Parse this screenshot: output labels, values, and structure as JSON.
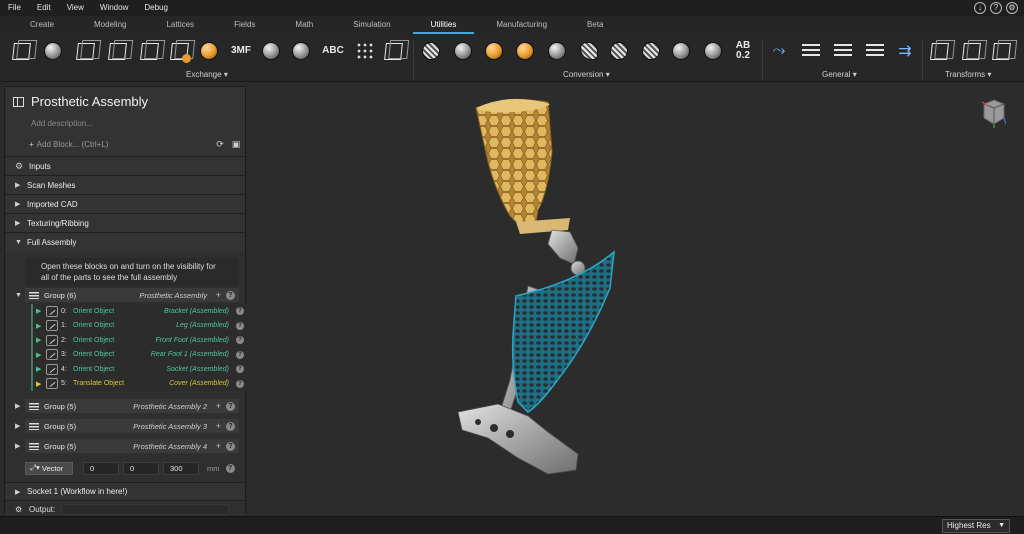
{
  "menu": [
    "File",
    "Edit",
    "View",
    "Window",
    "Debug"
  ],
  "window_icons": [
    "download-icon",
    "help-icon",
    "settings-icon"
  ],
  "tabs": [
    {
      "label": "Create",
      "active": false
    },
    {
      "label": "Modeling",
      "active": false
    },
    {
      "label": "Lattices",
      "active": false
    },
    {
      "label": "Fields",
      "active": false
    },
    {
      "label": "Math",
      "active": false
    },
    {
      "label": "Simulation",
      "active": false
    },
    {
      "label": "Utilities",
      "active": true
    },
    {
      "label": "Manufacturing",
      "active": false
    },
    {
      "label": "Beta",
      "active": false
    }
  ],
  "ribbon": {
    "groups": [
      "Exchange",
      "Conversion",
      "General",
      "Transforms"
    ],
    "icon_texts": {
      "threemf": "3MF",
      "abc": "ABC",
      "ab": "AB",
      "ab_value": "0.2"
    },
    "accent": "#e89a2c"
  },
  "panel": {
    "title": "Prosthetic Assembly",
    "description_placeholder": "Add description...",
    "add_block": "Add Block... (Ctrl+L)",
    "sections": {
      "inputs": "Inputs",
      "scan_meshes": "Scan Meshes",
      "imported_cad": "Imported CAD",
      "texturing": "Texturing/Ribbing",
      "full_assembly": "Full Assembly",
      "socket": "Socket 1 (Workflow in here!)"
    },
    "note": "Open these blocks on and turn on the visibility for all of the parts to see the full assembly",
    "group_main": {
      "name": "Group (6)",
      "label": "Prosthetic Assembly"
    },
    "children": [
      {
        "index": "0:",
        "name": "Orient Object",
        "target": "Bracket (Assembled)"
      },
      {
        "index": "1:",
        "name": "Orient Object",
        "target": "Leg (Assembled)"
      },
      {
        "index": "2:",
        "name": "Orient Object",
        "target": "Front Foot (Assembled)"
      },
      {
        "index": "3:",
        "name": "Orient Object",
        "target": "Rear Foot 1 (Assembled)"
      },
      {
        "index": "4:",
        "name": "Orient Object",
        "target": "Socket (Assembled)"
      },
      {
        "index": "5:",
        "name": "Translate Object",
        "target": "Cover (Assembled)"
      }
    ],
    "groups": [
      {
        "name": "Group (5)",
        "label": "Prosthetic Assembly 2"
      },
      {
        "name": "Group (5)",
        "label": "Prosthetic Assembly 3"
      },
      {
        "name": "Group (5)",
        "label": "Prosthetic Assembly 4"
      }
    ],
    "vector": {
      "label": "Vector",
      "x": "0",
      "y": "0",
      "z": "300",
      "unit": "mm"
    },
    "output_label": "Output:"
  },
  "status": {
    "resolution": "Highest Res"
  },
  "colors": {
    "socket": "#d8aa55",
    "cover": "#2aa6c8",
    "metal": "#b8b8b8",
    "active_tab": "#3aa8d6"
  }
}
